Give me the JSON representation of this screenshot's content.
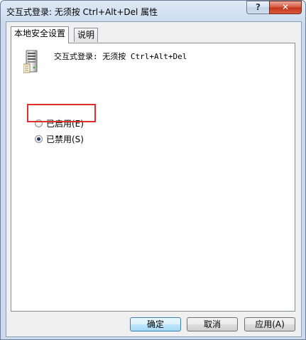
{
  "window": {
    "title": "交互式登录: 无须按 Ctrl+Alt+Del 属性",
    "help_label": "?",
    "close_label": "✕"
  },
  "tabs": [
    {
      "label": "本地安全设置",
      "active": true
    },
    {
      "label": "说明",
      "active": false
    }
  ],
  "policy": {
    "name": "交互式登录: 无须按 Ctrl+Alt+Del",
    "icon": "server-icon"
  },
  "options": [
    {
      "label": "已启用(E)",
      "checked": false
    },
    {
      "label": "已禁用(S)",
      "checked": true
    }
  ],
  "buttons": {
    "ok": "确定",
    "cancel": "取消",
    "apply": "应用(A)"
  },
  "colors": {
    "highlight": "#e0302b",
    "close": "#c2351b"
  }
}
